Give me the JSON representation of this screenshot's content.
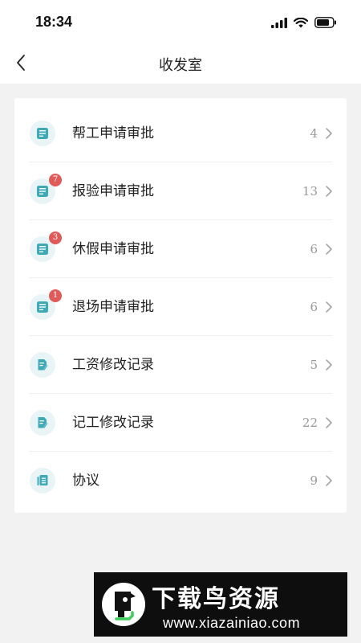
{
  "status_bar": {
    "time": "18:34",
    "icons": [
      "signal-icon",
      "wifi-icon",
      "battery-icon"
    ]
  },
  "nav": {
    "title": "收发室",
    "back_icon": "chevron-left-icon"
  },
  "list": [
    {
      "label": "帮工申请审批",
      "count": "4",
      "badge": "",
      "icon": "form-icon"
    },
    {
      "label": "报验申请审批",
      "count": "13",
      "badge": "7",
      "icon": "form-icon"
    },
    {
      "label": "休假申请审批",
      "count": "6",
      "badge": "3",
      "icon": "form-icon"
    },
    {
      "label": "退场申请审批",
      "count": "6",
      "badge": "1",
      "icon": "form-icon"
    },
    {
      "label": "工资修改记录",
      "count": "5",
      "badge": "",
      "icon": "edit-document-icon"
    },
    {
      "label": "记工修改记录",
      "count": "22",
      "badge": "",
      "icon": "edit-document-icon"
    },
    {
      "label": "协议",
      "count": "9",
      "badge": "",
      "icon": "document-list-icon"
    }
  ],
  "colors": {
    "accent": "#3fa9b8",
    "icon_bg": "#e8f4f6",
    "badge": "#e05a59",
    "page_bg": "#f2f2f2"
  },
  "watermark": {
    "title": "下载鸟资源",
    "url": "www.xiazainiao.com"
  }
}
